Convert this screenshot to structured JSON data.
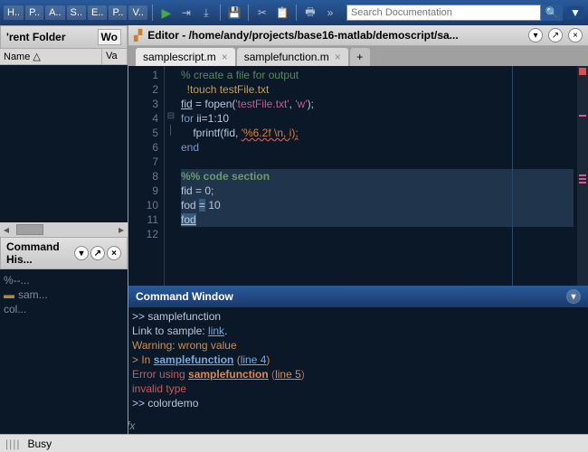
{
  "toolbar": {
    "tabs": [
      "H..",
      "P..",
      "A..",
      "S..",
      "E..",
      "P..",
      "V.."
    ],
    "search_placeholder": "Search Documentation"
  },
  "folder": {
    "title": "'rent Folder",
    "extra_tab": "Wo",
    "cols": {
      "name": "Name △",
      "value": "Va"
    }
  },
  "history": {
    "title": "Command His...",
    "items": [
      {
        "text": "%--...",
        "mark": false
      },
      {
        "text": "sam...",
        "mark": true
      },
      {
        "text": "col...",
        "mark": false
      }
    ]
  },
  "editor": {
    "title": "Editor - /home/andy/projects/base16-matlab/demoscript/sa...",
    "tabs": [
      {
        "label": "samplescript.m",
        "active": true
      },
      {
        "label": "samplefunction.m",
        "active": false
      }
    ],
    "lines": [
      "1",
      "2",
      "3",
      "4",
      "5",
      "6",
      "7",
      "8",
      "9",
      "10",
      "11",
      "12"
    ],
    "code": {
      "l1_comment": "% create a file for output",
      "l2_bang": "!",
      "l2_cmd": "touch testFile.txt",
      "l3a": "fid",
      "l3b": " = fopen(",
      "l3c": "'testFile.txt'",
      "l3d": ", ",
      "l3e": "'w'",
      "l3f": ");",
      "l4a": "for ",
      "l4b": "ii=1:10",
      "l5a": "    fprintf(fid, ",
      "l5b": "'%6.2f \\n, i);",
      "l6": "end",
      "l8": "%% code section",
      "l9": "fid = 0;",
      "l10a": "fod ",
      "l10b": "=",
      "l10c": " 10",
      "l11": "fod"
    }
  },
  "cmdwin": {
    "title": "Command Window",
    "l1": ">> samplefunction",
    "l2a": "Link to sample: ",
    "l2b": "link",
    "l2c": ".",
    "l3": "Warning: wrong value",
    "l4a": "> In ",
    "l4b": "samplefunction",
    "l4c": " (",
    "l4d": "line 4",
    "l4e": ")",
    "l5a": "Error using ",
    "l5b": "samplefunction",
    "l5c": " (",
    "l5d": "line 5",
    "l5e": ")",
    "l6": "invalid type",
    "l7": ">> colordemo"
  },
  "status": {
    "text": "Busy"
  }
}
